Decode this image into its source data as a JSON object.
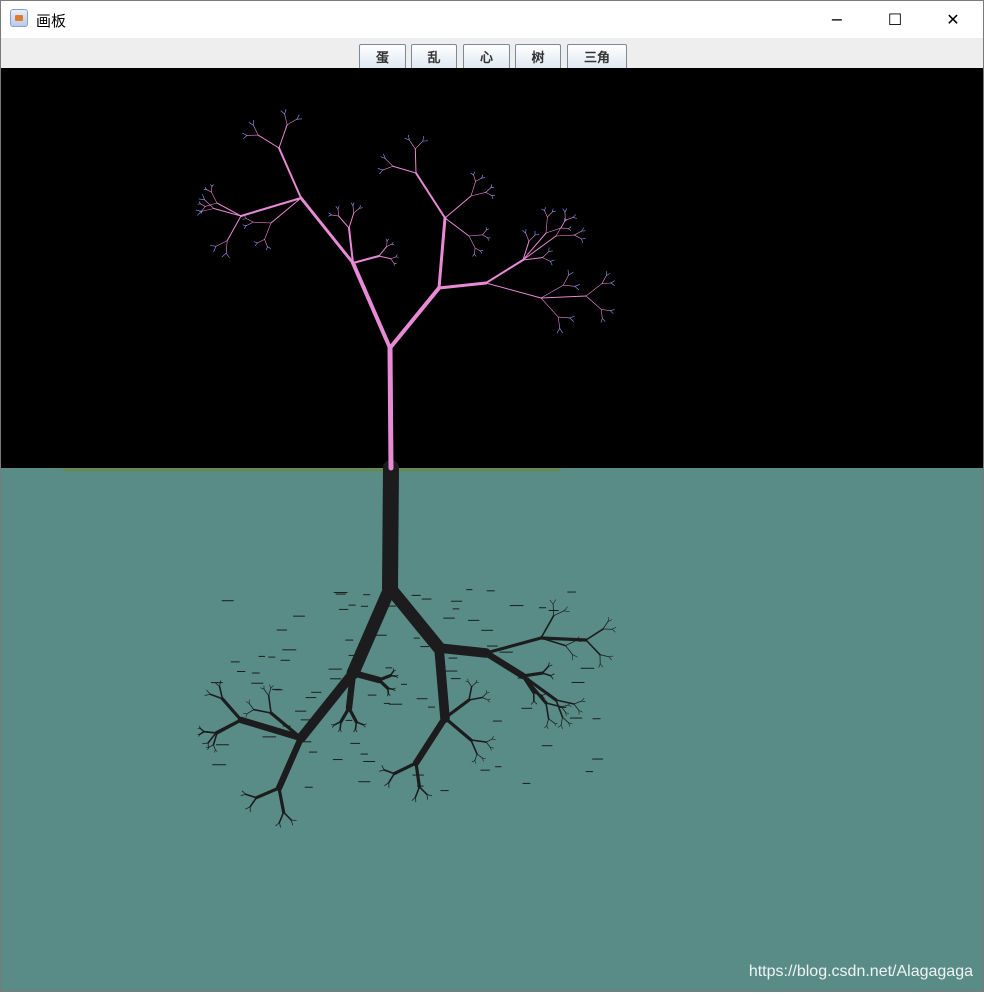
{
  "window": {
    "title": "画板",
    "controls": {
      "minimize": "−",
      "maximize": "☐",
      "close": "✕"
    }
  },
  "toolbar": {
    "buttons": [
      {
        "id": "egg",
        "label": "蛋"
      },
      {
        "id": "chaos",
        "label": "乱"
      },
      {
        "id": "heart",
        "label": "心"
      },
      {
        "id": "tree",
        "label": "树"
      },
      {
        "id": "triangle",
        "label": "三角"
      }
    ]
  },
  "canvas": {
    "sky_color": "#000000",
    "water_color": "#5a8c87",
    "tree_color": "#e88ad6",
    "tree_tip_color": "#8fa0ff",
    "reflection_color": "#1c1c1e",
    "horizon_color": "#6f8a33"
  },
  "watermark": "https://blog.csdn.net/Alagagaga"
}
